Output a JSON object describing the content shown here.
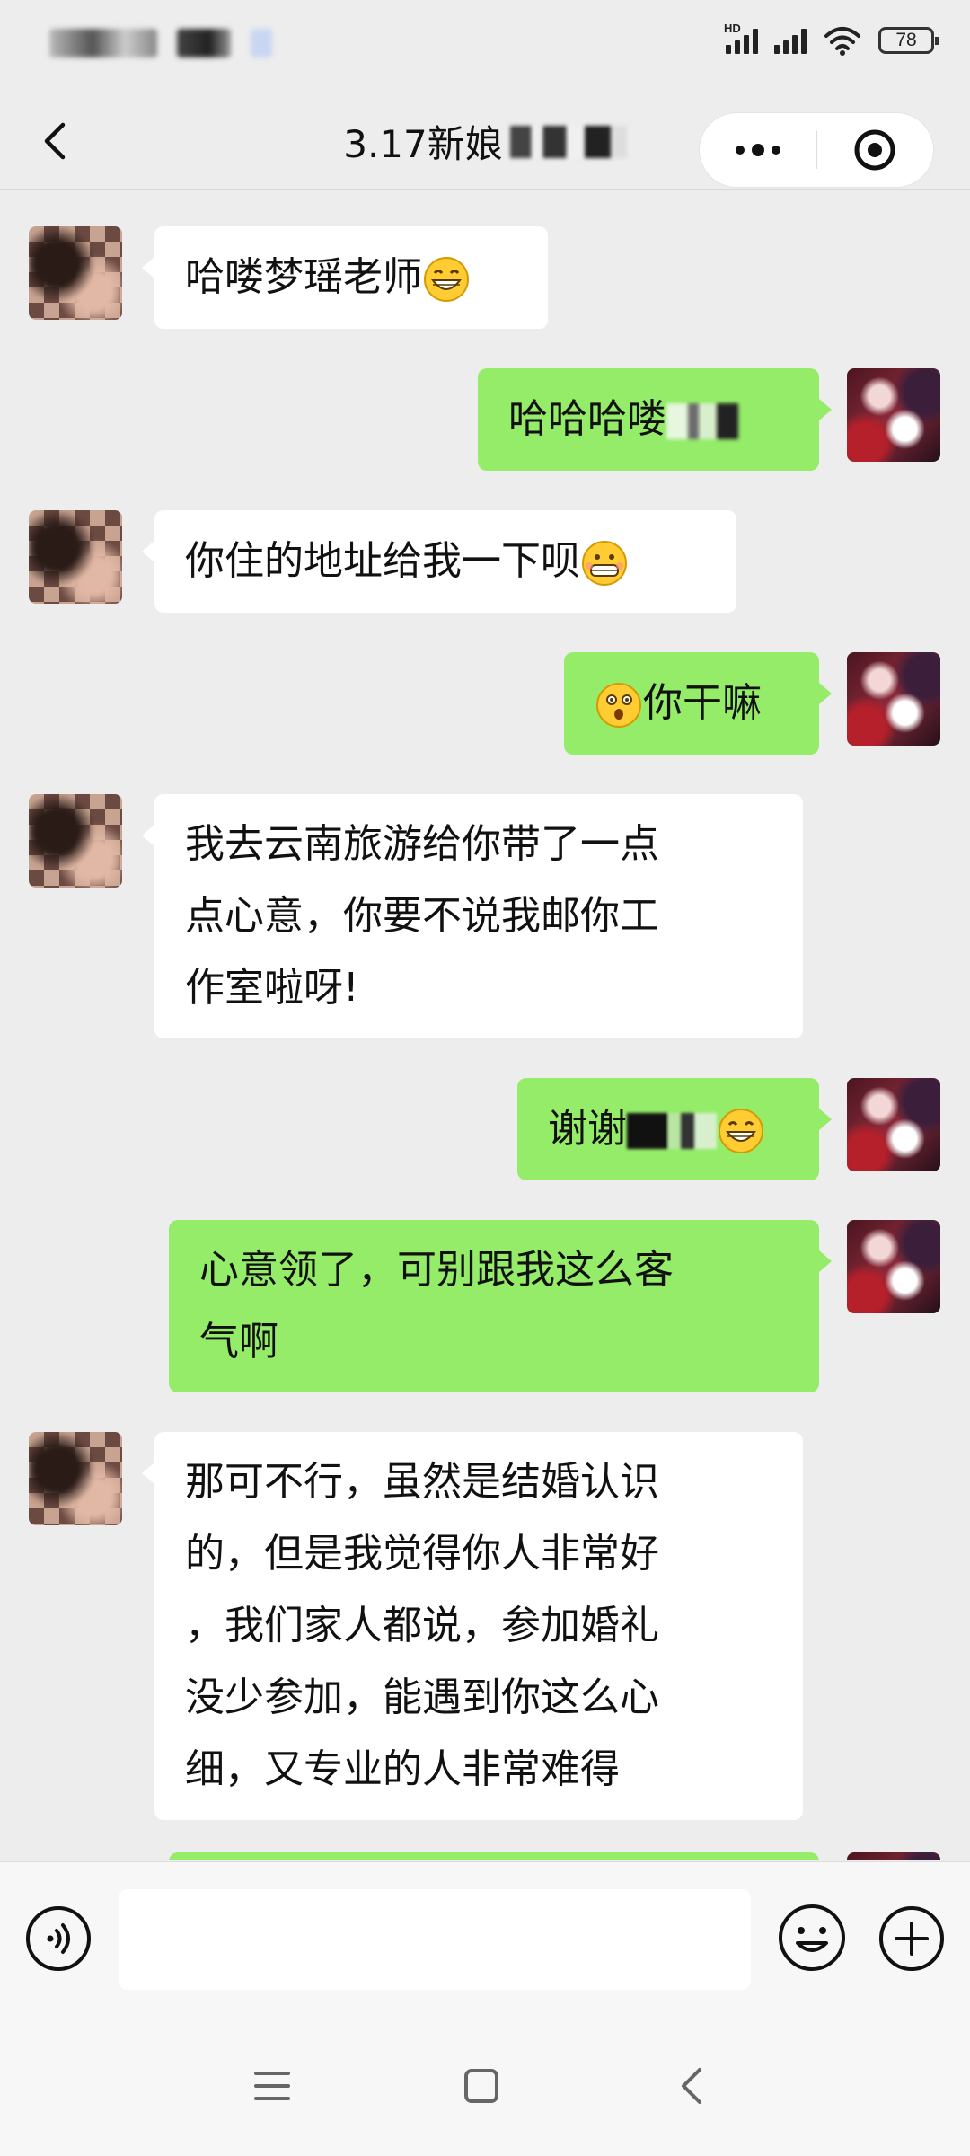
{
  "header": {
    "title": "3.17新娘"
  },
  "messages": [
    {
      "side": "in",
      "text": "哈喽梦瑶老师",
      "emoji": "grinning-face"
    },
    {
      "side": "out",
      "text": "哈哈哈喽",
      "redacted": true
    },
    {
      "side": "in",
      "text": "你住的地址给我一下呗",
      "emoji": "grimacing-face"
    },
    {
      "side": "out",
      "text": "你干嘛",
      "emoji": "surprised-face"
    },
    {
      "side": "in",
      "lines": [
        "我去云南旅游给你带了一点",
        "点心意，你要不说我邮你工",
        "作室啦呀!"
      ]
    },
    {
      "side": "out",
      "text": "谢谢",
      "redacted": true,
      "emoji": "grinning-face"
    },
    {
      "side": "out",
      "lines": [
        "心意领了，可别跟我这么客",
        "气啊"
      ]
    },
    {
      "side": "in",
      "lines": [
        "那可不行，虽然是结婚认识",
        "的，但是我觉得你人非常好",
        "，我们家人都说，参加婚礼",
        "没少参加，能遇到你这么心",
        "细，又专业的人非常难得"
      ]
    }
  ],
  "status_bar": {
    "battery": "78",
    "network_badge": "HD"
  },
  "icons": {
    "back": "chevron-left-icon",
    "more": "more-dots-icon",
    "close": "target-circle-icon",
    "voice": "voice-icon",
    "emoji": "smiley-icon",
    "plus": "plus-icon",
    "nav_menu": "menu-icon",
    "nav_home": "home-icon",
    "nav_back": "back-icon"
  },
  "colors": {
    "background": "#ededed",
    "outgoing_bubble": "#95ec69",
    "incoming_bubble": "#ffffff"
  }
}
